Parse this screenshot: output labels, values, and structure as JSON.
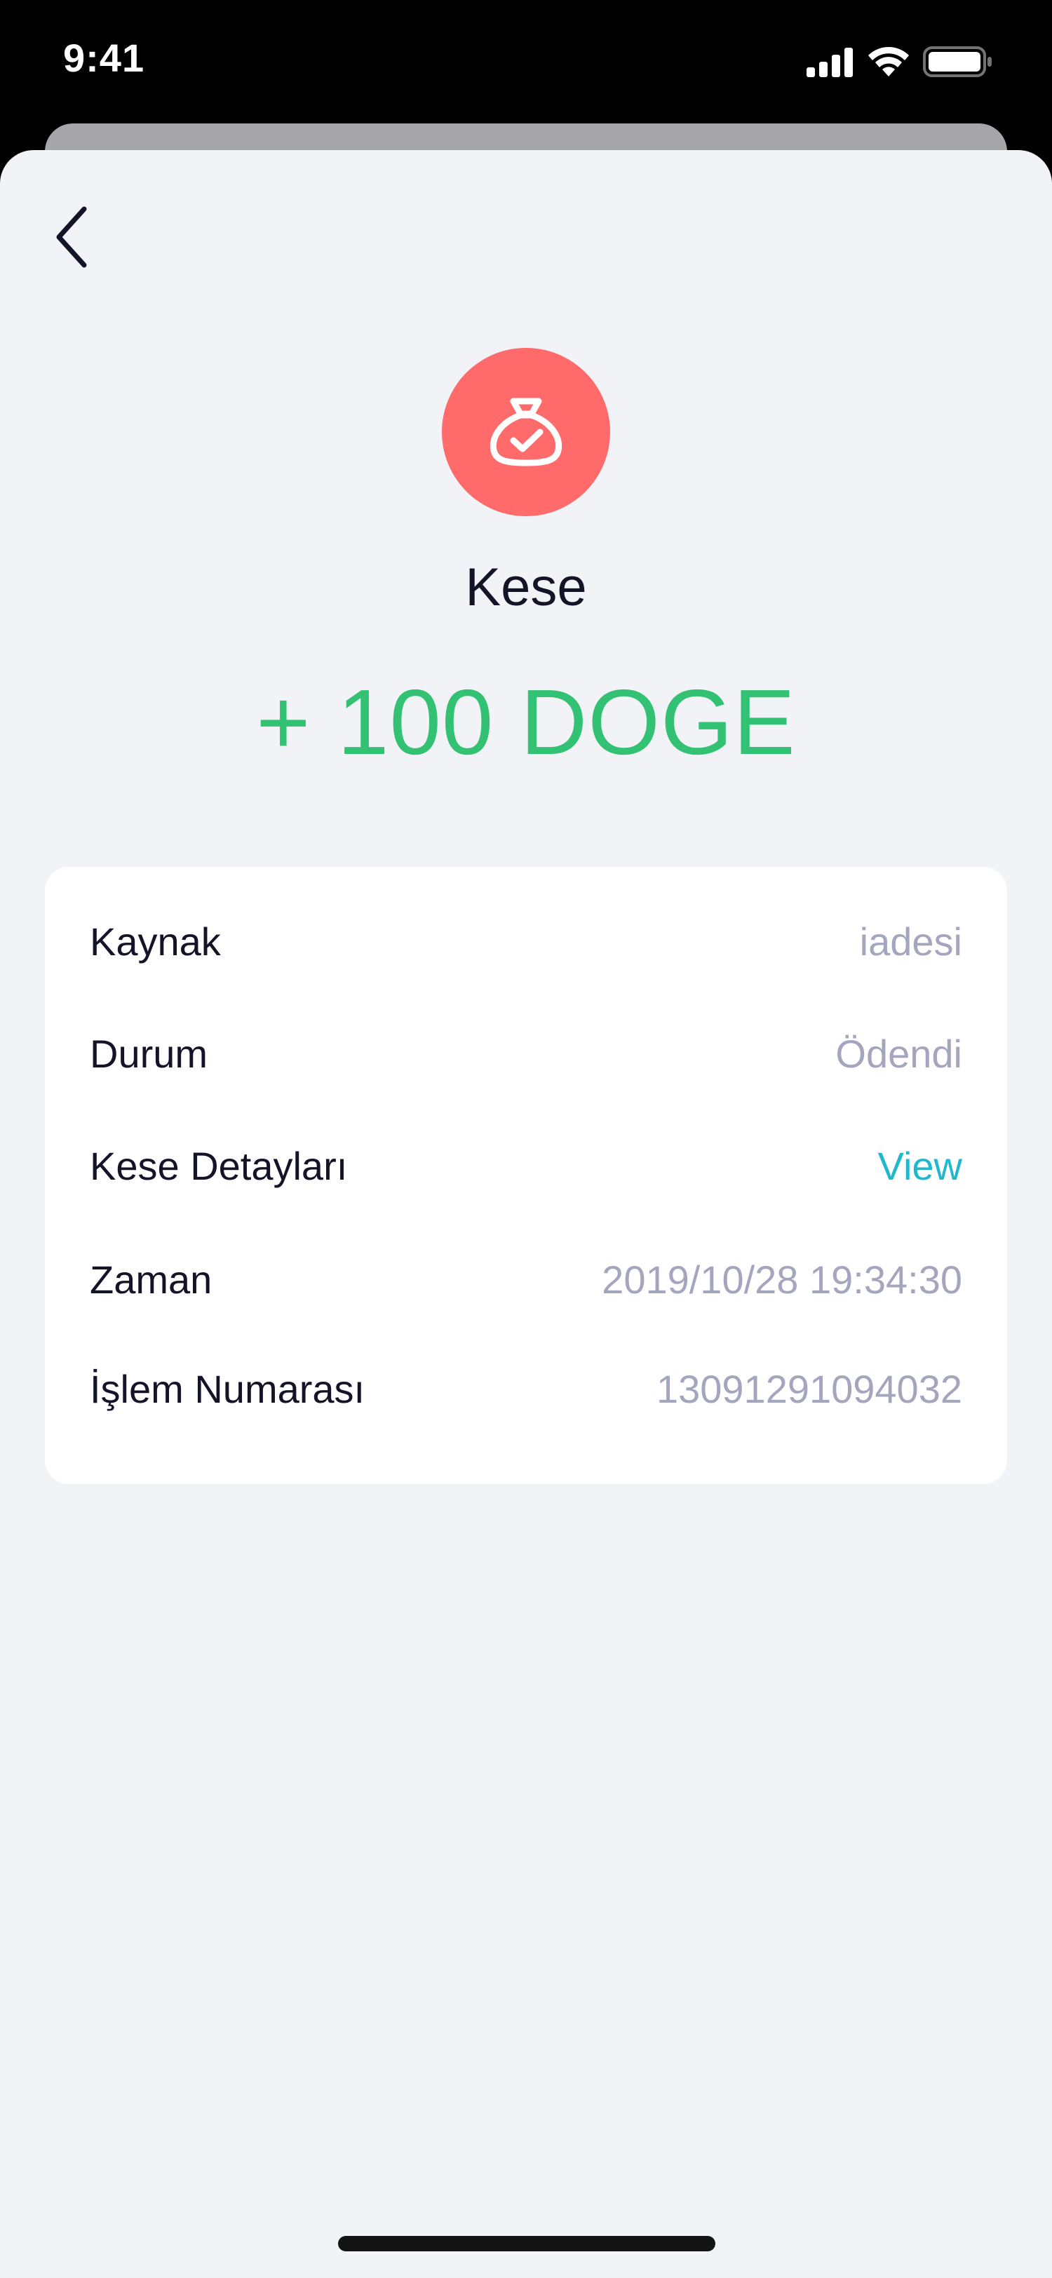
{
  "status_bar": {
    "time": "9:41",
    "icons": [
      "cellular-signal-icon",
      "wifi-icon",
      "battery-icon"
    ]
  },
  "header": {
    "back_icon": "chevron-left-icon"
  },
  "transaction": {
    "icon": "money-bag-check-icon",
    "icon_bg_color": "#ff6b6b",
    "title": "Kese",
    "amount": "+ 100 DOGE",
    "amount_color": "#33c173"
  },
  "details": {
    "rows": [
      {
        "label": "Kaynak",
        "value": "iadesi"
      },
      {
        "label": "Durum",
        "value": "Ödendi"
      },
      {
        "label": "Kese Detayları",
        "value": "View",
        "link_color": "#1fb8cf"
      },
      {
        "label": "Zaman",
        "value": "2019/10/28 19:34:30"
      },
      {
        "label": "İşlem Numarası",
        "value": "13091291094032"
      }
    ]
  }
}
